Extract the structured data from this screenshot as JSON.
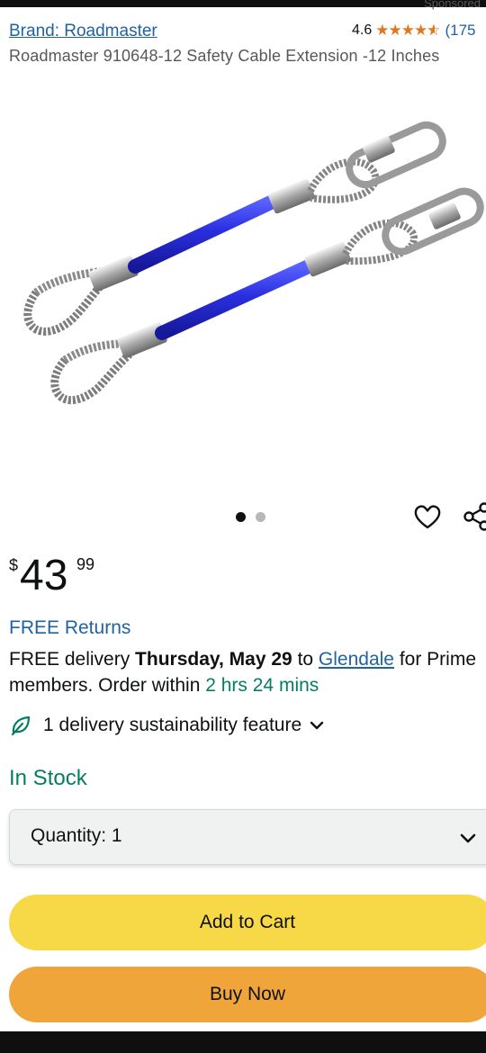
{
  "header": {
    "sponsored": "Sponsored",
    "brand_link": "Brand: Roadmaster",
    "rating_value": "4.6",
    "rating_stars": 4.6,
    "rating_count": "(175"
  },
  "product": {
    "title": "Roadmaster 910648-12 Safety Cable Extension -12 Inches",
    "image_icon": "product-photo",
    "image_count": 2,
    "active_image_index": 0
  },
  "icons": {
    "favorite": "heart-icon",
    "share": "share-icon",
    "sustainability": "leaf-icon",
    "expand": "chevron-down-icon"
  },
  "price": {
    "symbol": "$",
    "whole": "43",
    "fraction": "99"
  },
  "returns": {
    "label": "FREE Returns"
  },
  "delivery": {
    "prefix": "FREE delivery ",
    "date": "Thursday, May 29",
    "to": " to ",
    "location": "Glendale",
    "suffix": " for Prime members. Order within ",
    "countdown": "2 hrs 24 mins"
  },
  "sustainability": {
    "label": "1 delivery sustainability feature"
  },
  "stock": {
    "status": "In Stock"
  },
  "quantity": {
    "label": "Quantity:",
    "value": "1"
  },
  "actions": {
    "add_to_cart": "Add to Cart",
    "buy_now": "Buy Now"
  },
  "colors": {
    "link": "#2162a1",
    "in_stock": "#067d62",
    "star": "#de7921",
    "add_to_cart": "#f7d846",
    "buy_now": "#f0a53b"
  }
}
